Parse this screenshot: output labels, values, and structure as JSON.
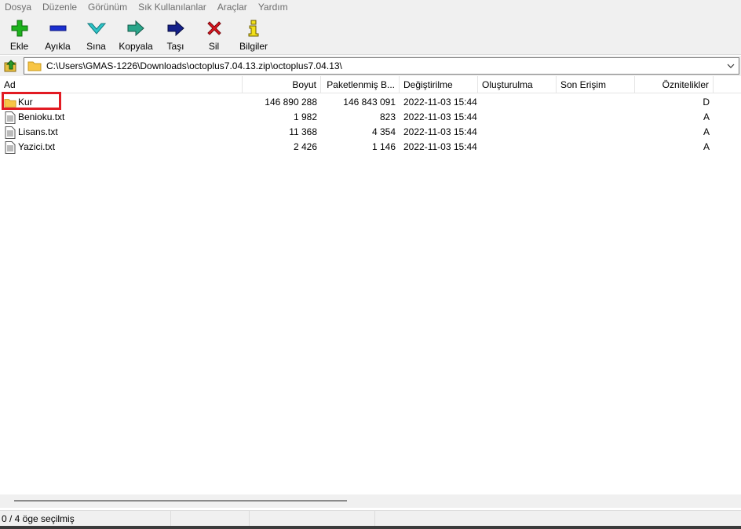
{
  "menu": [
    "Dosya",
    "Düzenle",
    "Görünüm",
    "Sık Kullanılanlar",
    "Araçlar",
    "Yardım"
  ],
  "toolbar": [
    {
      "label": "Ekle",
      "icon": "plus-icon"
    },
    {
      "label": "Ayıkla",
      "icon": "minus-icon"
    },
    {
      "label": "Sına",
      "icon": "check-icon"
    },
    {
      "label": "Kopyala",
      "icon": "copy-arrow-icon"
    },
    {
      "label": "Taşı",
      "icon": "move-arrow-icon"
    },
    {
      "label": "Sil",
      "icon": "delete-x-icon"
    },
    {
      "label": "Bilgiler",
      "icon": "info-icon"
    }
  ],
  "address": {
    "path": "C:\\Users\\GMAS-1226\\Downloads\\octoplus7.04.13.zip\\octoplus7.04.13\\"
  },
  "columns": [
    "Ad",
    "Boyut",
    "Paketlenmiş B...",
    "Değiştirilme",
    "Oluşturulma",
    "Son Erişim",
    "Öznitelikler"
  ],
  "files": [
    {
      "name": "Kur",
      "type": "folder",
      "size": "146 890 288",
      "packed": "146 843 091",
      "modified": "2022-11-03 15:44",
      "created": "",
      "accessed": "",
      "attr": "D"
    },
    {
      "name": "Benioku.txt",
      "type": "file",
      "size": "1 982",
      "packed": "823",
      "modified": "2022-11-03 15:44",
      "created": "",
      "accessed": "",
      "attr": "A"
    },
    {
      "name": "Lisans.txt",
      "type": "file",
      "size": "11 368",
      "packed": "4 354",
      "modified": "2022-11-03 15:44",
      "created": "",
      "accessed": "",
      "attr": "A"
    },
    {
      "name": "Yazici.txt",
      "type": "file",
      "size": "2 426",
      "packed": "1 146",
      "modified": "2022-11-03 15:44",
      "created": "",
      "accessed": "",
      "attr": "A"
    }
  ],
  "status": {
    "selection": "0 / 4 öge seçilmiş"
  },
  "colors": {
    "highlight_box": "#e21b23",
    "folder": "#f8c545",
    "add_green": "#1db21d",
    "delete_red": "#e0141e"
  }
}
